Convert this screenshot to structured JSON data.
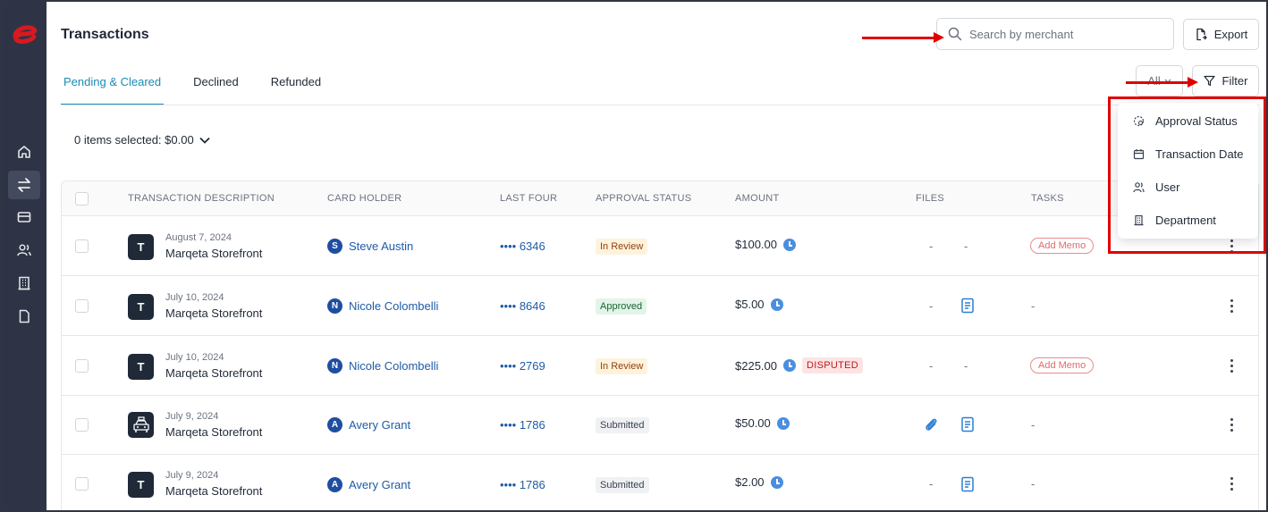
{
  "page": {
    "title": "Transactions"
  },
  "sidebar": {
    "logo": "marqeta-logo",
    "items": [
      {
        "name": "home",
        "icon": "home-icon"
      },
      {
        "name": "transactions",
        "icon": "transfer-icon",
        "active": true
      },
      {
        "name": "cards",
        "icon": "card-icon"
      },
      {
        "name": "users",
        "icon": "users-icon"
      },
      {
        "name": "departments",
        "icon": "building-icon"
      },
      {
        "name": "documents",
        "icon": "document-icon"
      }
    ]
  },
  "search": {
    "placeholder": "Search by merchant",
    "icon": "search-icon"
  },
  "export": {
    "label": "Export",
    "icon": "export-icon"
  },
  "tabs": [
    {
      "label": "Pending & Cleared",
      "active": true
    },
    {
      "label": "Declined"
    },
    {
      "label": "Refunded"
    }
  ],
  "toolbar": {
    "all_label": "All",
    "filter_label": "Filter"
  },
  "selection": {
    "summary": "0 items selected: $0.00"
  },
  "table": {
    "columns": [
      "TRANSACTION DESCRIPTION",
      "CARD HOLDER",
      "LAST FOUR",
      "APPROVAL STATUS",
      "AMOUNT",
      "FILES",
      "TASKS"
    ],
    "rows": [
      {
        "date": "August 7, 2024",
        "merchant": "Marqeta Storefront",
        "merchant_icon": "T",
        "holder_initial": "S",
        "holder": "Steve Austin",
        "last_four": "•••• 6346",
        "status": "In Review",
        "amount": "$100.00",
        "disputed": "",
        "files": [
          "-",
          "-"
        ],
        "task": "Add Memo"
      },
      {
        "date": "July 10, 2024",
        "merchant": "Marqeta Storefront",
        "merchant_icon": "T",
        "holder_initial": "N",
        "holder": "Nicole Colombelli",
        "last_four": "•••• 8646",
        "status": "Approved",
        "amount": "$5.00",
        "disputed": "",
        "files": [
          "-",
          "doc"
        ],
        "task": "-"
      },
      {
        "date": "July 10, 2024",
        "merchant": "Marqeta Storefront",
        "merchant_icon": "T",
        "holder_initial": "N",
        "holder": "Nicole Colombelli",
        "last_four": "•••• 2769",
        "status": "In Review",
        "amount": "$225.00",
        "disputed": "DISPUTED",
        "files": [
          "-",
          "-"
        ],
        "task": "Add Memo"
      },
      {
        "date": "July 9, 2024",
        "merchant": "Marqeta Storefront",
        "merchant_icon": "taxi",
        "holder_initial": "A",
        "holder": "Avery Grant",
        "last_four": "•••• 1786",
        "status": "Submitted",
        "amount": "$50.00",
        "disputed": "",
        "files": [
          "clip",
          "doc"
        ],
        "task": "-"
      },
      {
        "date": "July 9, 2024",
        "merchant": "Marqeta Storefront",
        "merchant_icon": "T",
        "holder_initial": "A",
        "holder": "Avery Grant",
        "last_four": "•••• 1786",
        "status": "Submitted",
        "amount": "$2.00",
        "disputed": "",
        "files": [
          "-",
          "doc"
        ],
        "task": "-"
      }
    ]
  },
  "filter_menu": {
    "items": [
      {
        "label": "Approval Status",
        "icon": "approval-status-icon"
      },
      {
        "label": "Transaction Date",
        "icon": "calendar-icon"
      },
      {
        "label": "User",
        "icon": "user-icon"
      },
      {
        "label": "Department",
        "icon": "building-icon"
      }
    ]
  },
  "colors": {
    "accent": "#1a8cb3",
    "sidebar": "#2e3445",
    "annotation": "#e00000",
    "brand": "#d71920"
  }
}
